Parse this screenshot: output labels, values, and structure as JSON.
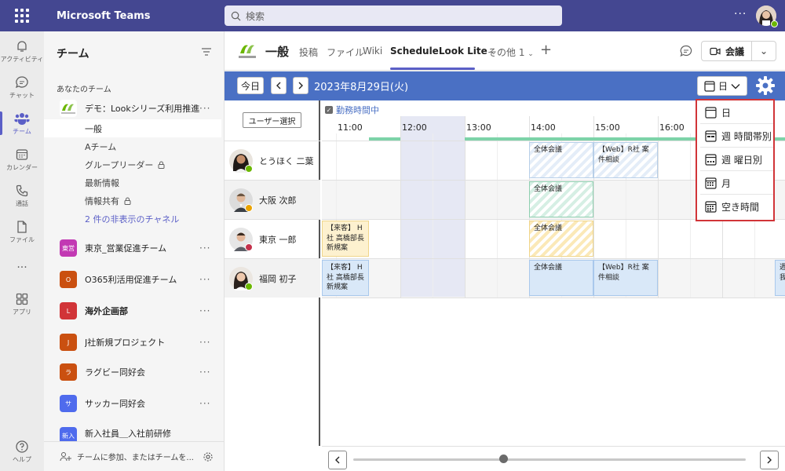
{
  "titlebar": {
    "app_title": "Microsoft Teams",
    "search_placeholder": "検索",
    "more": "···"
  },
  "rail": {
    "items": [
      {
        "label": "アクティビティ",
        "icon": "bell-icon"
      },
      {
        "label": "チャット",
        "icon": "chat-icon"
      },
      {
        "label": "チーム",
        "icon": "teams-icon"
      },
      {
        "label": "カレンダー",
        "icon": "calendar-icon"
      },
      {
        "label": "通話",
        "icon": "phone-icon"
      },
      {
        "label": "ファイル",
        "icon": "file-icon"
      },
      {
        "label": "···",
        "icon": "more-icon"
      },
      {
        "label": "アプリ",
        "icon": "apps-icon"
      },
      {
        "label": "ヘルプ",
        "icon": "help-icon"
      }
    ]
  },
  "teams_panel": {
    "title": "チーム",
    "section_label": "あなたのチーム",
    "main_team": "デモ：Lookシリーズ利用推進",
    "channels": [
      "一般",
      "Aチーム",
      "グループリーダー",
      "最新情報",
      "情報共有"
    ],
    "hidden_channels": "2 件の非表示のチャネル",
    "teams": [
      {
        "name": "東京_営業促進チーム",
        "badge": "東営",
        "color": "#c239b3",
        "bold": false
      },
      {
        "name": "O365利活用促進チーム",
        "badge": "O",
        "color": "#ca5010",
        "bold": false
      },
      {
        "name": "海外企画部",
        "badge": "L",
        "color": "#d13438",
        "bold": true
      },
      {
        "name": "J社新規プロジェクト",
        "badge": "J",
        "color": "#ca5010",
        "bold": false
      },
      {
        "name": "ラグビー同好会",
        "badge": "ラ",
        "color": "#ca5010",
        "bold": false
      },
      {
        "name": "サッカー同好会",
        "badge": "サ",
        "color": "#4f6bed",
        "bold": false
      },
      {
        "name": "新入社員＿入社前研修",
        "badge": "新入",
        "color": "#4f6bed",
        "bold": false
      }
    ],
    "footer": "チームに参加、またはチームを..."
  },
  "channel_header": {
    "name": "一般",
    "tabs": [
      "投稿",
      "ファイル",
      "Wiki",
      "ScheduleLook Lite",
      "その他 1"
    ],
    "plus": "+",
    "meet_label": "会議"
  },
  "schedule": {
    "today_label": "今日",
    "date": "2023年8月29日(火)",
    "view_label": "日",
    "user_select_label": "ユーザー選択",
    "work_hours_label": "勤務時間中",
    "hours": [
      "11:00",
      "12:00",
      "13:00",
      "14:00",
      "15:00",
      "16:00"
    ],
    "users": [
      {
        "name": "とうほく 二葉",
        "status_color": "#6bb700"
      },
      {
        "name": "大阪 次郎",
        "status_color": "#eaa300"
      },
      {
        "name": "東京 一郎",
        "status_color": "#c4314b"
      },
      {
        "name": "福岡 初子",
        "status_color": "#6bb700"
      }
    ],
    "events": {
      "e1": "全体会議",
      "e2": "【Web】R社 案件相談",
      "e3": "全体会議",
      "e4": "【来客】 H社 高橋部長 新規案",
      "e5": "全体会議",
      "e6": "【来客】 H社 高橋部長 新規案",
      "e7": "全体会議",
      "e8": "【Web】R社 案件相談",
      "e9": "週 我"
    }
  },
  "view_dropdown": {
    "options": [
      {
        "label": "日",
        "icon": "day-view-icon"
      },
      {
        "label": "週 時間帯別",
        "icon": "week-time-view-icon"
      },
      {
        "label": "週 曜日別",
        "icon": "week-day-view-icon"
      },
      {
        "label": "月",
        "icon": "month-view-icon"
      },
      {
        "label": "空き時間",
        "icon": "free-time-view-icon"
      }
    ]
  },
  "colors": {
    "titlebar": "#444791",
    "accent": "#5b5fc7",
    "schedule_bar": "#4a70c4",
    "highlight_border": "#d13438"
  }
}
